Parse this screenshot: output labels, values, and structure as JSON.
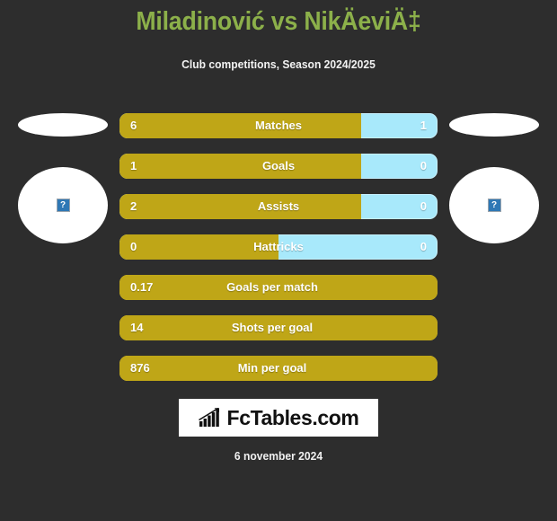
{
  "header": {
    "title": "Miladinović vs NikÄeviÄ‡",
    "subtitle": "Club competitions, Season 2024/2025"
  },
  "players": {
    "home": {
      "name": "",
      "photo_alt": "?",
      "photo_state": "broken-image"
    },
    "away": {
      "name": "",
      "photo_alt": "?",
      "photo_state": "broken-image"
    }
  },
  "colors": {
    "background": "#2d2d2d",
    "title": "#8cb04a",
    "home_bar": "#bfa617",
    "away_bar": "#a8e9fb",
    "text": "#ffffff",
    "logo_panel": "#ffffff"
  },
  "footer": {
    "logo_text": "FcTables.com",
    "logo_icon": "bar-chart-growth-icon",
    "date": "6 november 2024"
  },
  "chart_data": {
    "type": "bar",
    "title": "Miladinović vs NikÄeviÄ‡",
    "subtitle": "Club competitions, Season 2024/2025",
    "xlabel": "",
    "ylabel": "",
    "orientation": "horizontal-diverging",
    "legend": [
      "Miladinović",
      "NikÄeviÄ‡"
    ],
    "categories": [
      "Matches",
      "Goals",
      "Assists",
      "Hattricks",
      "Goals per match",
      "Shots per goal",
      "Min per goal"
    ],
    "series": [
      {
        "name": "Miladinović",
        "values": [
          6,
          1,
          2,
          0,
          0.17,
          14,
          876
        ]
      },
      {
        "name": "NikÄeviÄ‡",
        "values": [
          1,
          0,
          0,
          0,
          null,
          null,
          null
        ]
      }
    ],
    "rows": [
      {
        "label": "Matches",
        "home": "6",
        "away": "1",
        "home_pct": 76,
        "two_sided": true
      },
      {
        "label": "Goals",
        "home": "1",
        "away": "0",
        "home_pct": 76,
        "two_sided": true
      },
      {
        "label": "Assists",
        "home": "2",
        "away": "0",
        "home_pct": 76,
        "two_sided": true
      },
      {
        "label": "Hattricks",
        "home": "0",
        "away": "0",
        "home_pct": 50,
        "two_sided": true
      },
      {
        "label": "Goals per match",
        "home": "0.17",
        "away": "",
        "home_pct": 100,
        "two_sided": false
      },
      {
        "label": "Shots per goal",
        "home": "14",
        "away": "",
        "home_pct": 100,
        "two_sided": false
      },
      {
        "label": "Min per goal",
        "home": "876",
        "away": "",
        "home_pct": 100,
        "two_sided": false
      }
    ]
  }
}
